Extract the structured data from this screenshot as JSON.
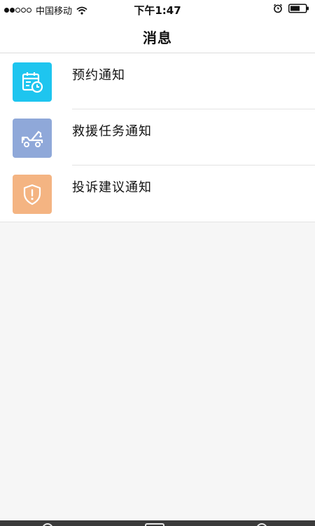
{
  "status_bar": {
    "carrier": "中国移动",
    "time": "下午1:47",
    "signal_full": 2,
    "signal_total": 5,
    "wifi_icon": "wifi-icon",
    "alarm_icon": "alarm-icon",
    "battery_icon": "battery-icon"
  },
  "nav": {
    "title": "消息"
  },
  "notifications": [
    {
      "label": "预约通知",
      "icon": "calendar-clock-icon",
      "color": "#1ec5ef"
    },
    {
      "label": "救援任务通知",
      "icon": "tow-truck-icon",
      "color": "#8fa8d9"
    },
    {
      "label": "投诉建议通知",
      "icon": "shield-alert-icon",
      "color": "#f4b482"
    }
  ],
  "colors": {
    "background": "#f6f6f6",
    "tab_bar": "#3a3a3a"
  }
}
